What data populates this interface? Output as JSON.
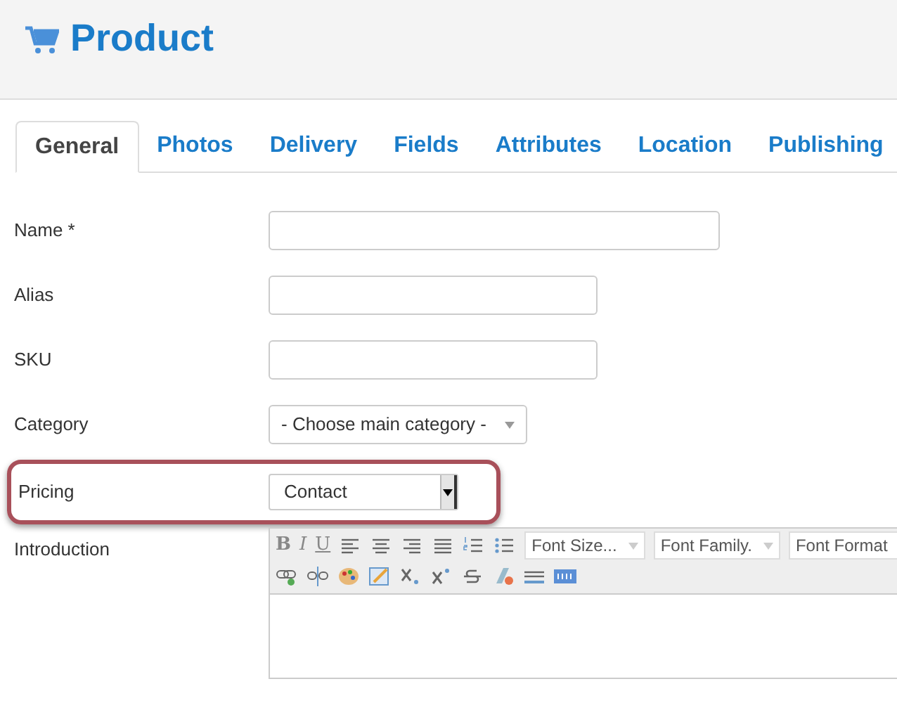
{
  "header": {
    "title": "Product"
  },
  "tabs": [
    {
      "label": "General",
      "selected": true
    },
    {
      "label": "Photos",
      "selected": false
    },
    {
      "label": "Delivery",
      "selected": false
    },
    {
      "label": "Fields",
      "selected": false
    },
    {
      "label": "Attributes",
      "selected": false
    },
    {
      "label": "Location",
      "selected": false
    },
    {
      "label": "Publishing",
      "selected": false
    }
  ],
  "fields": [
    {
      "kind": "wideinput",
      "label": "Name *",
      "highlighted": false
    },
    {
      "kind": "input",
      "label": "Alias",
      "highlighted": false
    },
    {
      "kind": "input",
      "label": "SKU",
      "highlighted": false
    },
    {
      "kind": "select",
      "label": "Category",
      "value": "- Choose main category -",
      "highlighted": false
    },
    {
      "kind": "dropdown",
      "label": "Pricing",
      "value": "Contact",
      "highlighted": true
    },
    {
      "kind": "editor",
      "label": "Introduction",
      "letters": [
        "B",
        "I",
        "U"
      ],
      "dropdowns": [
        "Font Size...",
        "Font Family.",
        "Font Format"
      ],
      "highlighted": false
    }
  ]
}
